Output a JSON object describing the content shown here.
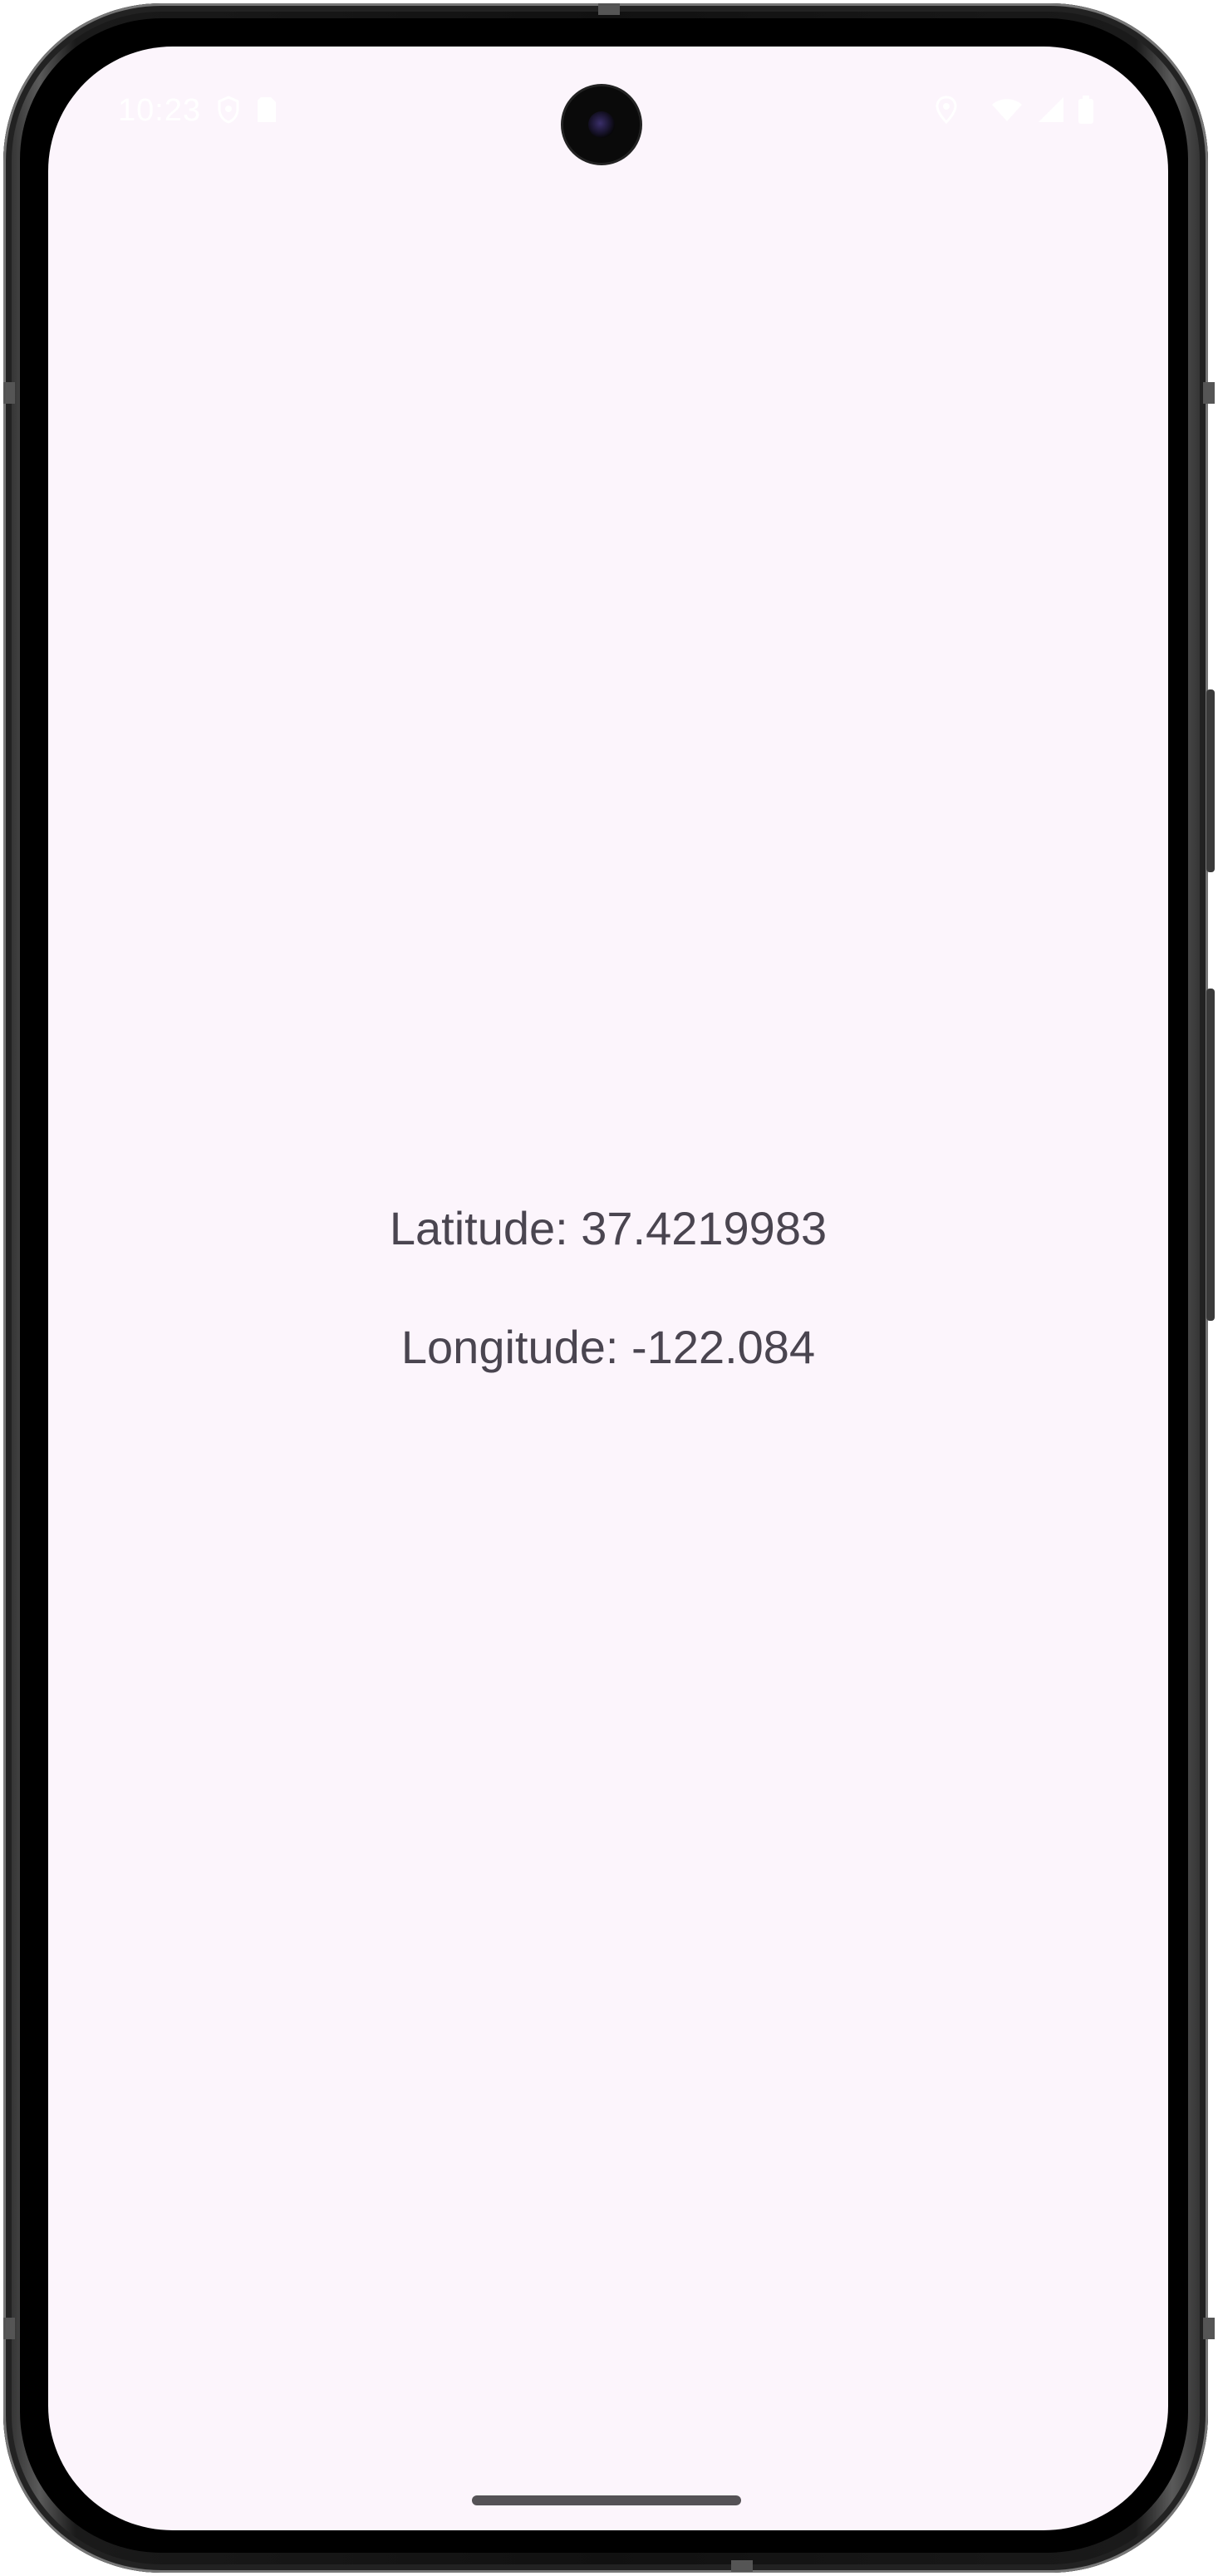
{
  "status_bar": {
    "time": "10:23",
    "icons": [
      "vpn-key-icon",
      "sim-card-icon",
      "location-icon",
      "wifi-icon",
      "cellular-signal-icon",
      "battery-icon"
    ]
  },
  "main": {
    "latitude_text": "Latitude: 37.4219983",
    "longitude_text": "Longitude: -122.084"
  },
  "colors": {
    "screen_background": "#fcf5fc",
    "text": "#4a4550"
  }
}
